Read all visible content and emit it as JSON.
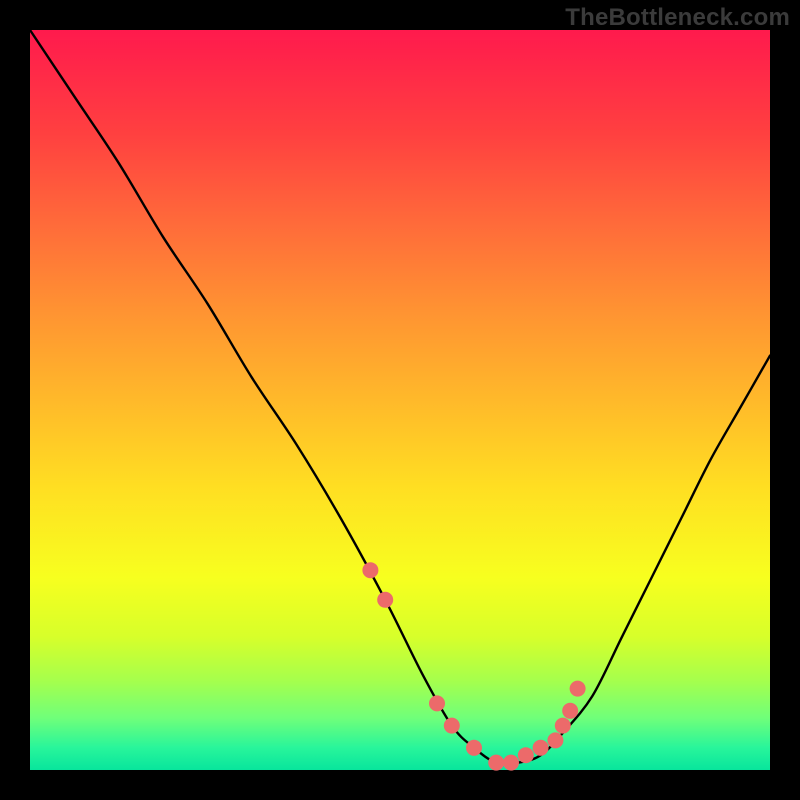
{
  "watermark": "TheBottleneck.com",
  "chart_data": {
    "type": "line",
    "title": "",
    "xlabel": "",
    "ylabel": "",
    "xlim": [
      0,
      100
    ],
    "ylim": [
      0,
      100
    ],
    "series": [
      {
        "name": "bottleneck-curve",
        "x": [
          0,
          6,
          12,
          18,
          24,
          30,
          36,
          42,
          48,
          53,
          57,
          60,
          63,
          66,
          69,
          72,
          76,
          80,
          84,
          88,
          92,
          96,
          100
        ],
        "values": [
          100,
          91,
          82,
          72,
          63,
          53,
          44,
          34,
          23,
          13,
          6,
          3,
          1,
          1,
          2,
          5,
          10,
          18,
          26,
          34,
          42,
          49,
          56
        ]
      }
    ],
    "markers": {
      "name": "highlight-dots",
      "color": "#ec6a6a",
      "x": [
        46,
        48,
        55,
        57,
        60,
        63,
        65,
        67,
        69,
        71,
        72,
        73,
        74
      ],
      "values": [
        27,
        23,
        9,
        6,
        3,
        1,
        1,
        2,
        3,
        4,
        6,
        8,
        11
      ]
    }
  }
}
